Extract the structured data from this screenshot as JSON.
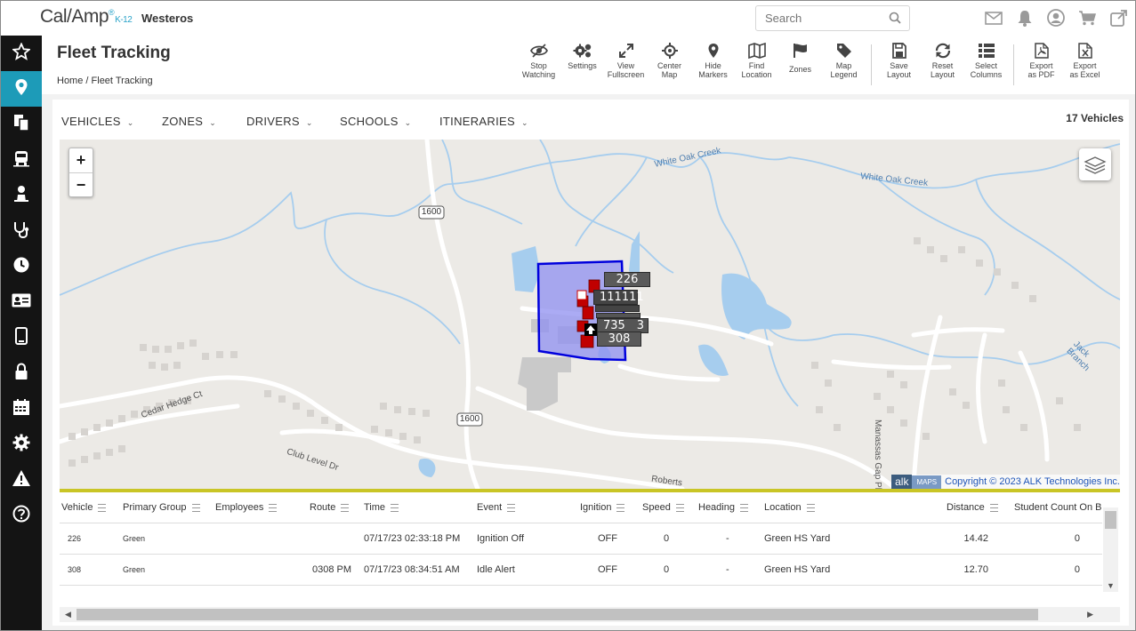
{
  "brand": {
    "logo_text": "Cal/Amp",
    "logo_suffix": "K-12",
    "org_name": "Westeros"
  },
  "search": {
    "placeholder": "Search"
  },
  "top_icons": [
    "mail-icon",
    "bell-icon",
    "user-icon",
    "cart-icon",
    "external-link-icon"
  ],
  "sidebar": {
    "items": [
      {
        "icon": "star-icon",
        "active": false
      },
      {
        "icon": "map-pin-icon",
        "active": true
      },
      {
        "icon": "documents-icon",
        "active": false
      },
      {
        "icon": "bus-icon",
        "active": false
      },
      {
        "icon": "person-icon",
        "active": false
      },
      {
        "icon": "stethoscope-icon",
        "active": false
      },
      {
        "icon": "clock-icon",
        "active": false
      },
      {
        "icon": "id-card-icon",
        "active": false
      },
      {
        "icon": "tablet-icon",
        "active": false
      },
      {
        "icon": "lock-icon",
        "active": false
      },
      {
        "icon": "calendar-icon",
        "active": false
      },
      {
        "icon": "gear-icon",
        "active": false
      },
      {
        "icon": "warning-icon",
        "active": false
      },
      {
        "icon": "help-icon",
        "active": false
      }
    ]
  },
  "page": {
    "title": "Fleet Tracking",
    "breadcrumb_home": "Home",
    "breadcrumb_sep": "/",
    "breadcrumb_current": "Fleet Tracking"
  },
  "toolbar": {
    "stop_watching": [
      "Stop",
      "Watching"
    ],
    "settings": [
      "Settings",
      ""
    ],
    "view_fullscreen": [
      "View",
      "Fullscreen"
    ],
    "center_map": [
      "Center",
      "Map"
    ],
    "hide_markers": [
      "Hide",
      "Markers"
    ],
    "find_location": [
      "Find",
      "Location"
    ],
    "zones": [
      "Zones",
      ""
    ],
    "map_legend": [
      "Map",
      "Legend"
    ],
    "save_layout": [
      "Save",
      "Layout"
    ],
    "reset_layout": [
      "Reset",
      "Layout"
    ],
    "select_columns": [
      "Select",
      "Columns"
    ],
    "export_pdf": [
      "Export",
      "as PDF"
    ],
    "export_excel": [
      "Export",
      "as Excel"
    ]
  },
  "filters": {
    "vehicles": "VEHICLES",
    "zones": "ZONES",
    "drivers": "DRIVERS",
    "schools": "SCHOOLS",
    "itineraries": "ITINERARIES"
  },
  "vehicle_count": "17 Vehicles",
  "map": {
    "zoom_in": "+",
    "zoom_out": "−",
    "road_labels": {
      "creek1": "White Oak Creek",
      "creek2": "White Oak Creek",
      "route_a": "1600",
      "route_b": "1600",
      "cedar": "Cedar Hedge Ct",
      "club": "Club Level Dr",
      "roberts": "Roberts",
      "manassas": "Manassas Gap Pl",
      "jack": "Jack Branch"
    },
    "vehicle_labels": {
      "l226": "226",
      "l111": "111111",
      "l735": "735",
      "l308": "308",
      "l3": "3"
    },
    "copyright": "Copyright © 2023 ALK Technologies Inc.",
    "alk": "alk",
    "maps": "MAPS"
  },
  "table": {
    "headers": {
      "vehicle": "Vehicle",
      "primary_group": "Primary Group",
      "employees": "Employees",
      "route": "Route",
      "time": "Time",
      "event": "Event",
      "ignition": "Ignition",
      "speed": "Speed",
      "heading": "Heading",
      "location": "Location",
      "distance": "Distance",
      "student_count": "Student Count On B"
    },
    "rows": [
      {
        "vehicle": "226",
        "group": "Green",
        "employees": "",
        "route": "",
        "time": "07/17/23 02:33:18 PM",
        "event": "Ignition Off",
        "ignition": "OFF",
        "speed": "0",
        "heading": "-",
        "location": "Green HS Yard",
        "distance": "14.42",
        "students": "0"
      },
      {
        "vehicle": "308",
        "group": "Green",
        "employees": "",
        "route": "0308 PM",
        "time": "07/17/23 08:34:51 AM",
        "event": "Idle Alert",
        "ignition": "OFF",
        "speed": "0",
        "heading": "-",
        "location": "Green HS Yard",
        "distance": "12.70",
        "students": "0"
      }
    ]
  },
  "colors": {
    "accent": "#1d9bb8",
    "sidebar": "#141414",
    "zone_fill": "#8f8ff0",
    "zone_border": "#0000dd",
    "water": "#a6cdee",
    "highlight_bar": "#c9c526"
  }
}
